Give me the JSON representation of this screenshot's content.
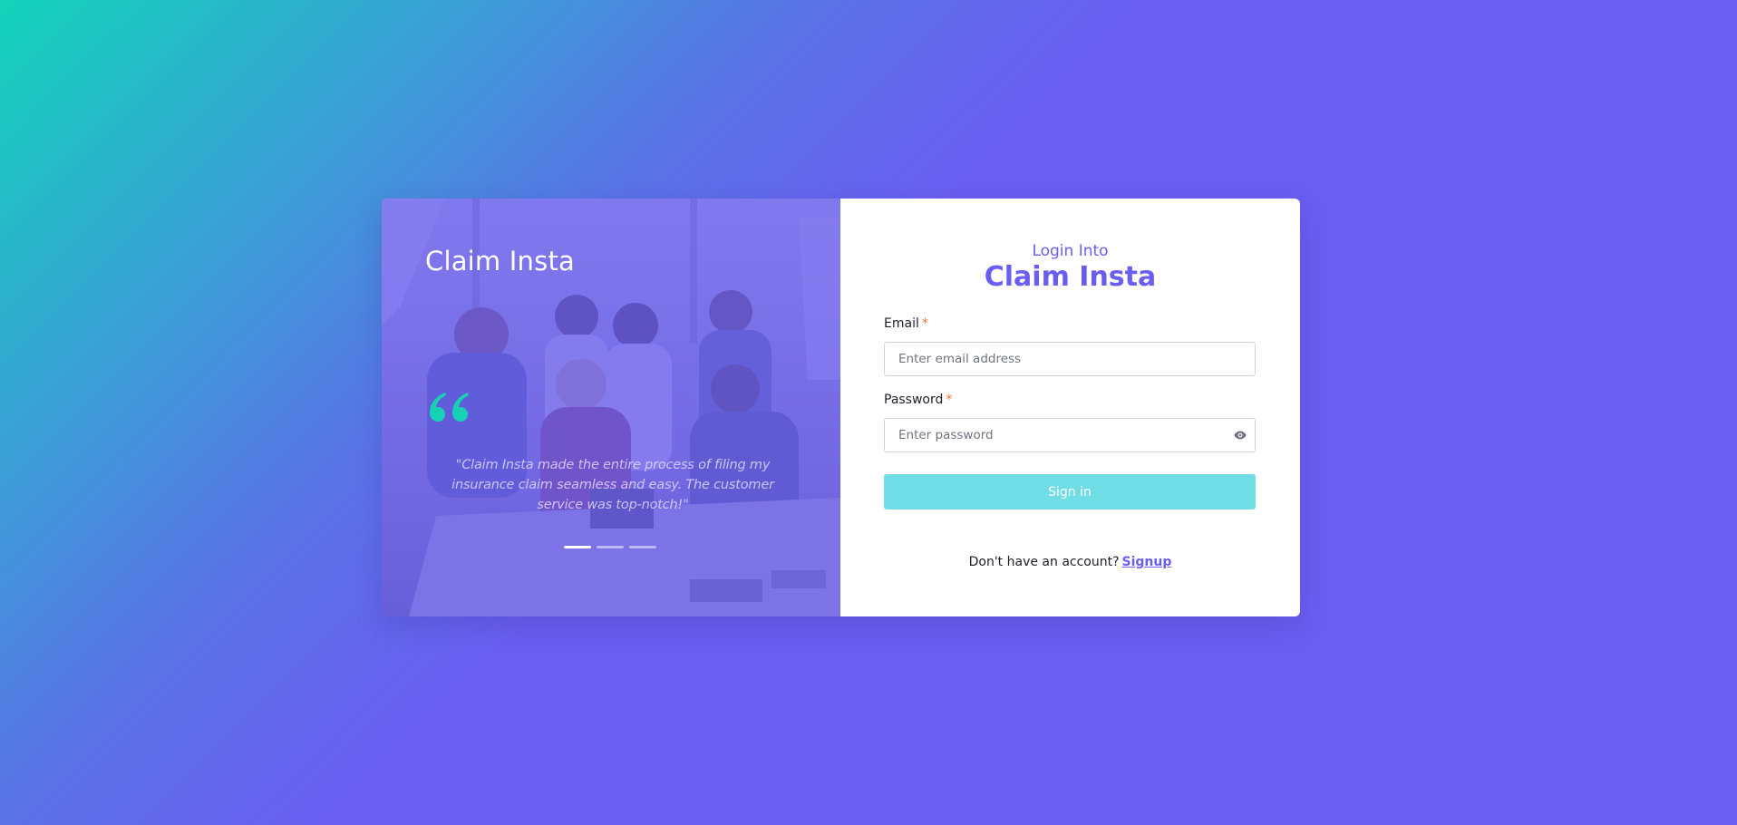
{
  "brand": {
    "name": "Claim Insta"
  },
  "testimonial": {
    "text": "\"Claim Insta made the entire process of filing my insurance claim seamless and easy. The customer service was top-notch!\"",
    "carousel_slides": 3,
    "active_slide": 1
  },
  "login": {
    "pre_title": "Login Into",
    "title": "Claim Insta",
    "email": {
      "label": "Email",
      "required_mark": "*",
      "placeholder": "Enter email address",
      "value": ""
    },
    "password": {
      "label": "Password",
      "required_mark": "*",
      "placeholder": "Enter password",
      "value": "",
      "toggle_icon": "eye-icon"
    },
    "submit_label": "Sign in",
    "footer_text": "Don't have an account?",
    "signup_label": "Signup"
  },
  "colors": {
    "accent": "#6a5ef1",
    "teal": "#12d3b9",
    "button": "#70dce6",
    "required": "#f0752f"
  }
}
